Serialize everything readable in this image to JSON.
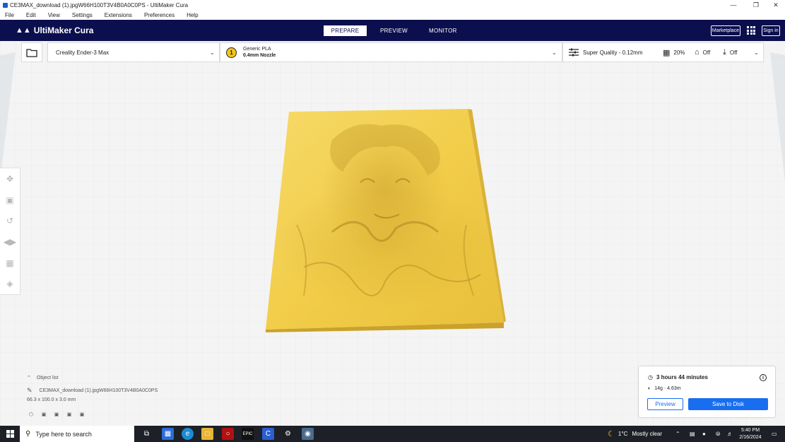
{
  "window": {
    "title": "CE3MAX_download (1).jpgW66H100T3V4B0A0C0PS - UltiMaker Cura",
    "minimize_icon": "minimize-icon",
    "restore_icon": "restore-icon",
    "close_icon": "close-icon"
  },
  "menu": [
    "File",
    "Edit",
    "View",
    "Settings",
    "Extensions",
    "Preferences",
    "Help"
  ],
  "header": {
    "logo": "UltiMaker Cura",
    "tabs": [
      "PREPARE",
      "PREVIEW",
      "MONITOR"
    ],
    "active_tab": 0,
    "marketplace": "Marketplace",
    "signin": "Sign in",
    "accent": "#0b0f4e"
  },
  "printer": {
    "name": "Creality Ender-3 Max"
  },
  "material": {
    "extruder": "1",
    "name": "Generic PLA",
    "nozzle": "0.4mm Nozzle",
    "color": "#f5c518"
  },
  "quality": {
    "profile": "Super Quality - 0.12mm",
    "infill": "20%",
    "support": "Off",
    "adhesion": "Off"
  },
  "object_list": {
    "heading": "Object list",
    "filename": "CE3MAX_download (1).jpgW66H100T3V4B0A0C0PS",
    "dimensions": "66.3 x 100.0 x 3.0 mm"
  },
  "print_panel": {
    "time": "3 hours 44 minutes",
    "material_usage": "14g · 4.63m",
    "preview_label": "Preview",
    "save_label": "Save to Disk",
    "accent": "#196ef0"
  },
  "taskbar": {
    "search_placeholder": "Type here to search",
    "weather": "1°C",
    "weather_text": "Mostly clear",
    "time": "5:40 PM",
    "date": "2/16/2024"
  }
}
